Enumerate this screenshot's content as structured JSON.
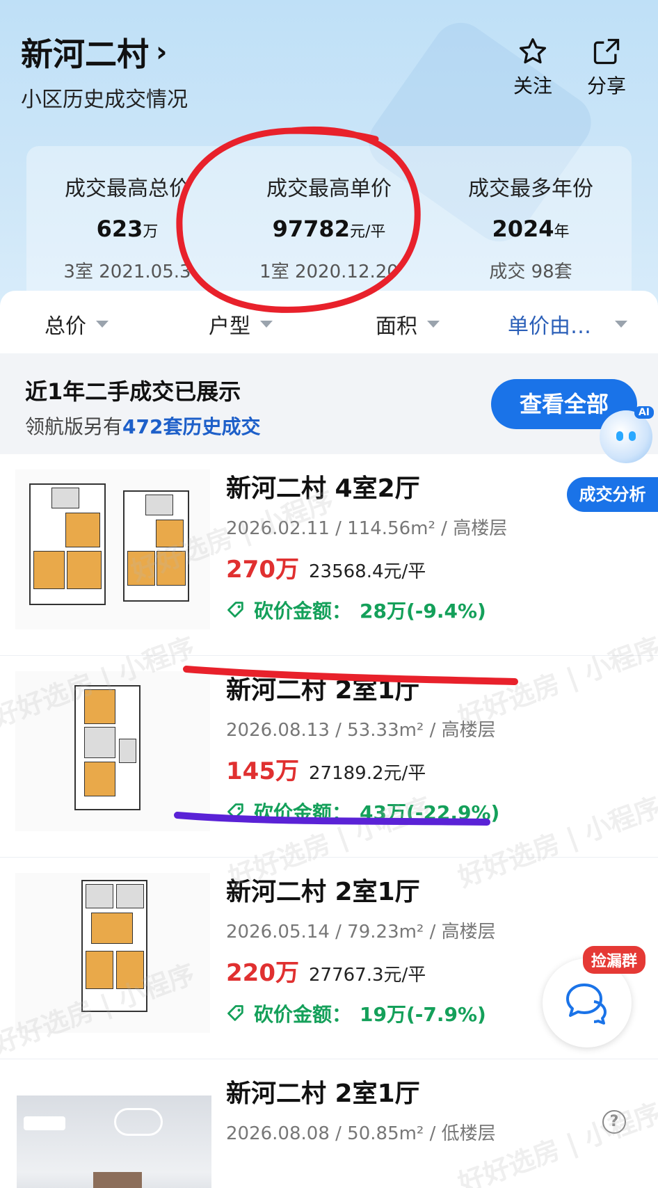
{
  "header": {
    "title": "新河二村",
    "chevron": "›",
    "subtitle": "小区历史成交情况",
    "actions": [
      {
        "label": "关注",
        "icon": "star-icon"
      },
      {
        "label": "分享",
        "icon": "share-icon"
      }
    ]
  },
  "stats": [
    {
      "label": "成交最高总价",
      "value": "623",
      "unit": "万",
      "sub": "3室 2021.05.3"
    },
    {
      "label": "成交最高单价",
      "value": "97782",
      "unit": "元/平",
      "sub": "1室 2020.12.20"
    },
    {
      "label": "成交最多年份",
      "value": "2024",
      "unit": "年",
      "sub": "成交 98套"
    }
  ],
  "filters": [
    {
      "label": "总价"
    },
    {
      "label": "户型"
    },
    {
      "label": "面积"
    },
    {
      "label": "单价由…",
      "active": true
    }
  ],
  "banner": {
    "line1": "近1年二手成交已展示",
    "line2_prefix": "领航版另有",
    "line2_highlight": "472套历史成交",
    "button": "查看全部"
  },
  "robot": {
    "badge": "AI"
  },
  "analysis_tag": "成交分析",
  "listings": [
    {
      "name": "新河二村 4室2厅",
      "date": "2026.02.11",
      "area": "114.56m²",
      "floor": "高楼层",
      "total": "270万",
      "unit_price": "23568.4元/平",
      "cut_label": "砍价金额：",
      "cut_value": "28万(-9.4%)"
    },
    {
      "name": "新河二村 2室1厅",
      "date": "2026.08.13",
      "area": "53.33m²",
      "floor": "高楼层",
      "total": "145万",
      "unit_price": "27189.2元/平",
      "cut_label": "砍价金额：",
      "cut_value": "43万(-22.9%)"
    },
    {
      "name": "新河二村 2室1厅",
      "date": "2026.05.14",
      "area": "79.23m²",
      "floor": "高楼层",
      "total": "220万",
      "unit_price": "27767.3元/平",
      "cut_label": "砍价金额：",
      "cut_value": "19万(-7.9%)"
    },
    {
      "name": "新河二村 2室1厅",
      "date": "2026.08.08",
      "area": "50.85m²",
      "floor": "低楼层",
      "total": "",
      "unit_price": "",
      "cut_label": "",
      "cut_value": ""
    }
  ],
  "watermark": "好好选房 | 小程序",
  "group_badge": "捡漏群",
  "help": "?",
  "colors": {
    "accent": "#1a73e8",
    "price_red": "#e03030",
    "cut_green": "#14a05a",
    "annot_red": "#e8212b",
    "annot_purple": "#5a22d6"
  }
}
